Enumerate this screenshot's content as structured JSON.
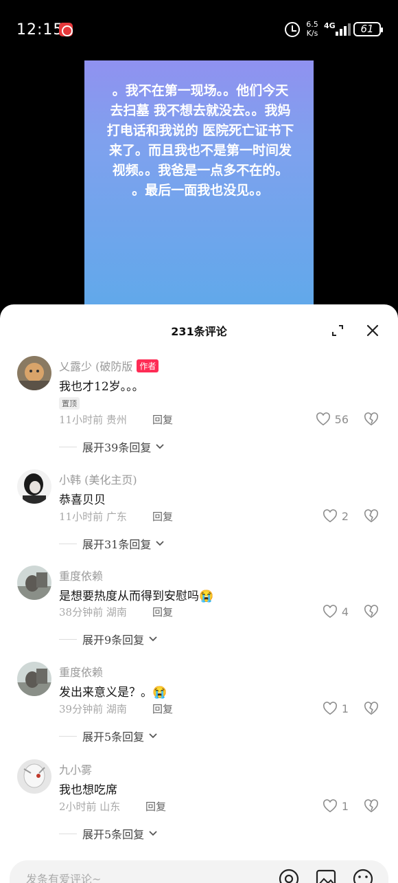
{
  "status_bar": {
    "time": "12:15",
    "net_speed_value": "6.5",
    "net_speed_unit": "K/s",
    "network": "4G",
    "battery": "61"
  },
  "video": {
    "caption": "。我不在第一现场。。他们今天\n去扫墓 我不想去就没去。。我妈\n打电话和我说的 医院死亡证书下\n来了。而且我也不是第一时间发\n视频。。我爸是一点多不在的。\n。最后一面我也没见。。"
  },
  "comments_panel": {
    "title": "231条评论",
    "comments": [
      {
        "name": "乂露少 (破防版",
        "author_tag": "作者",
        "text": "我也才12岁。。。",
        "pin_tag": "置顶",
        "meta": "11小时前 贵州",
        "reply": "回复",
        "likes": "56",
        "expand": "展开39条回复"
      },
      {
        "name": "小韩 (美化主页)",
        "text": "恭喜贝贝",
        "meta": "11小时前 广东",
        "reply": "回复",
        "likes": "2",
        "expand": "展开31条回复"
      },
      {
        "name": "重度依赖",
        "text": "是想要热度从而得到安慰吗😭",
        "meta": "38分钟前 湖南",
        "reply": "回复",
        "likes": "4",
        "expand": "展开9条回复"
      },
      {
        "name": "重度依赖",
        "text": "发出来意义是？。😭",
        "meta": "39分钟前 湖南",
        "reply": "回复",
        "likes": "1",
        "expand": "展开5条回复"
      },
      {
        "name": "九小雾",
        "text": "我也想吃席",
        "meta": "2小时前 山东",
        "reply": "回复",
        "likes": "1",
        "expand": "展开5条回复"
      }
    ]
  },
  "input": {
    "placeholder": "发条有爱评论~"
  },
  "colors": {
    "accent": "#fe2c55",
    "video_gradient_top": "#9c86f1",
    "video_gradient_bottom": "#5fa9ea"
  }
}
